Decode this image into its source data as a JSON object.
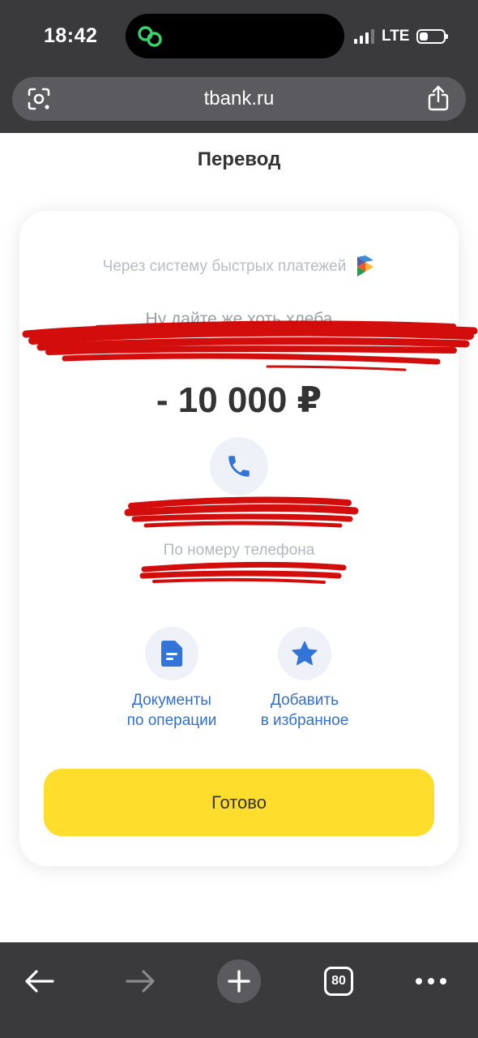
{
  "status_bar": {
    "time": "18:42",
    "network": "LTE"
  },
  "browser": {
    "url": "tbank.ru",
    "tab_count": "80"
  },
  "page": {
    "title": "Перевод",
    "payment_system": "Через систему быстрых платежей",
    "message": "Ну дайте же хоть хлеба",
    "amount": "- 10 000 ₽",
    "method": "По номеру телефона",
    "actions": [
      {
        "label": "Документы\nпо операции",
        "icon": "document-icon"
      },
      {
        "label": "Добавить\nв избранное",
        "icon": "star-icon"
      }
    ],
    "done_label": "Готово"
  },
  "colors": {
    "accent_yellow": "#ffdd2d",
    "link_blue": "#336fd0",
    "chrome_dark": "#3a3a3c",
    "redaction_red": "#d10000"
  }
}
